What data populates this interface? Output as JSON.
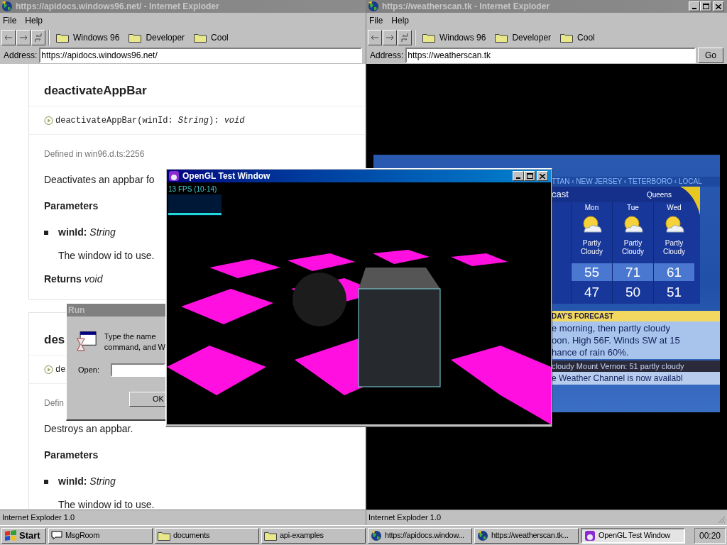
{
  "docs_browser": {
    "title": "https://apidocs.windows96.net/ - Internet Exploder",
    "active": false,
    "menu": [
      "File",
      "Help"
    ],
    "bookmarks": [
      "Windows 96",
      "Developer",
      "Cool"
    ],
    "address_label": "Address:",
    "address": "https://apidocs.windows96.net/",
    "status": "Internet Exploder 1.0",
    "sections": [
      {
        "heading": "deactivateAppBar",
        "signature": "deactivateAppBar(winId: *String*): *void*",
        "defined": "Defined in win96.d.ts:2256",
        "description": "Deactivates an appbar fo",
        "params_label": "Parameters",
        "params": [
          {
            "text": "**winId:** *String*",
            "description": "The window id to use."
          }
        ],
        "returns": "**Returns** *void*"
      },
      {
        "heading": "des",
        "signature": "de",
        "defined": "Defin",
        "description": "Destroys an appbar.",
        "params_label": "Parameters",
        "params": [
          {
            "text": "**winId:** *String*",
            "description": "The window id to use."
          }
        ]
      }
    ]
  },
  "weather_browser": {
    "title": "https://weatherscan.tk - Internet Exploder",
    "active": false,
    "menu": [
      "File",
      "Help"
    ],
    "bookmarks": [
      "Windows 96",
      "Developer",
      "Cool"
    ],
    "address_label": "Address:",
    "address": "https://weatherscan.tk",
    "go": "Go",
    "status": "Internet Exploder 1.0",
    "weather": {
      "ticker": "TTAN ‹ NEW JERSEY ‹ TETERBORO ‹ LOCAL",
      "header": "cast",
      "location": "Queens",
      "days": [
        {
          "day": "Mon",
          "condition": "Partly Cloudy",
          "high": "55",
          "low": "47"
        },
        {
          "day": "Tue",
          "condition": "Partly Cloudy",
          "high": "71",
          "low": "50"
        },
        {
          "day": "Wed",
          "condition": "Partly Cloudy",
          "high": "61",
          "low": "51"
        }
      ],
      "today_title": "DAY'S FORECAST",
      "today_lines": [
        "e morning, then partly cloudy",
        "oon. High 56F. Winds SW at 15",
        "hance of rain 60%."
      ],
      "crawl": "cloudy Mount Vernon: 51 partly cloudy",
      "notice": "e Weather Channel is now availabl"
    }
  },
  "run_dialog": {
    "title": "Run",
    "active": false,
    "prompt": [
      "Type the name",
      "command, and W"
    ],
    "open_label": "Open:",
    "ok": "OK"
  },
  "opengl_window": {
    "title": "OpenGL Test Window",
    "active": true,
    "fps": "13 FPS (10-14)"
  },
  "taskbar": {
    "start": "Start",
    "clock": "00:20",
    "items": [
      {
        "label": "MsgRoom",
        "kind": "chat",
        "selected": false
      },
      {
        "label": "documents",
        "kind": "folder",
        "selected": false
      },
      {
        "label": "api-examples",
        "kind": "folder",
        "selected": false
      },
      {
        "label": "https://apidocs.window...",
        "kind": "browser",
        "selected": false
      },
      {
        "label": "https://weatherscan.tk...",
        "kind": "browser",
        "selected": false
      },
      {
        "label": "OpenGL Test Window",
        "kind": "opengl",
        "selected": true
      }
    ]
  }
}
